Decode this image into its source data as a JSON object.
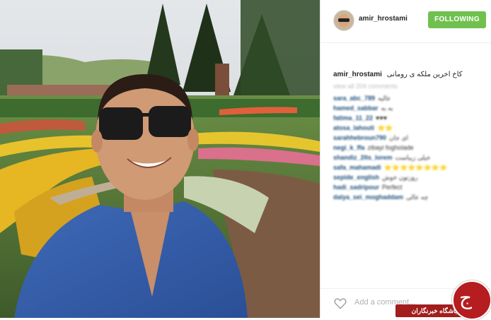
{
  "post": {
    "username": "amir_hrostami",
    "follow_button": "FOLLOWING",
    "caption_user": "amir_hrostami",
    "caption_text": "کاخ اخرین ملکه ی رومانی",
    "likes_text": "view all 204 comments",
    "comments": [
      {
        "user": "sara_abc_789",
        "text": "عالیه"
      },
      {
        "user": "hamed_sabbar",
        "text": "به به"
      },
      {
        "user": "fatima_11_22",
        "text": "♥♥♥"
      },
      {
        "user": "atosa_lahouti",
        "text": "⭐⭐"
      },
      {
        "user": "sarahhebroun790",
        "text": "ای جان"
      },
      {
        "user": "negi_k_ffa",
        "text": "zibayi fogholade"
      },
      {
        "user": "shandiz_2lts_lorem",
        "text": "خیلی زیباست"
      },
      {
        "user": "safa_mahamadi",
        "text": "⭐⭐⭐⭐⭐⭐⭐⭐"
      },
      {
        "user": "sepide_english",
        "text": "روزتون خوش"
      },
      {
        "user": "hadi_sadripour",
        "text": "Perfect"
      },
      {
        "user": "dalya_sei_moghaddam",
        "text": "چه عالی"
      }
    ],
    "add_comment_placeholder": "Add a comment..."
  },
  "watermark": {
    "label": "باشگاه خبرنگاران",
    "logo_letter": "ج"
  },
  "colors": {
    "follow_green": "#70c050",
    "watermark_red": "#a31d1d",
    "link_blue": "#1c4d7a"
  },
  "icons": [
    "heart-icon"
  ]
}
